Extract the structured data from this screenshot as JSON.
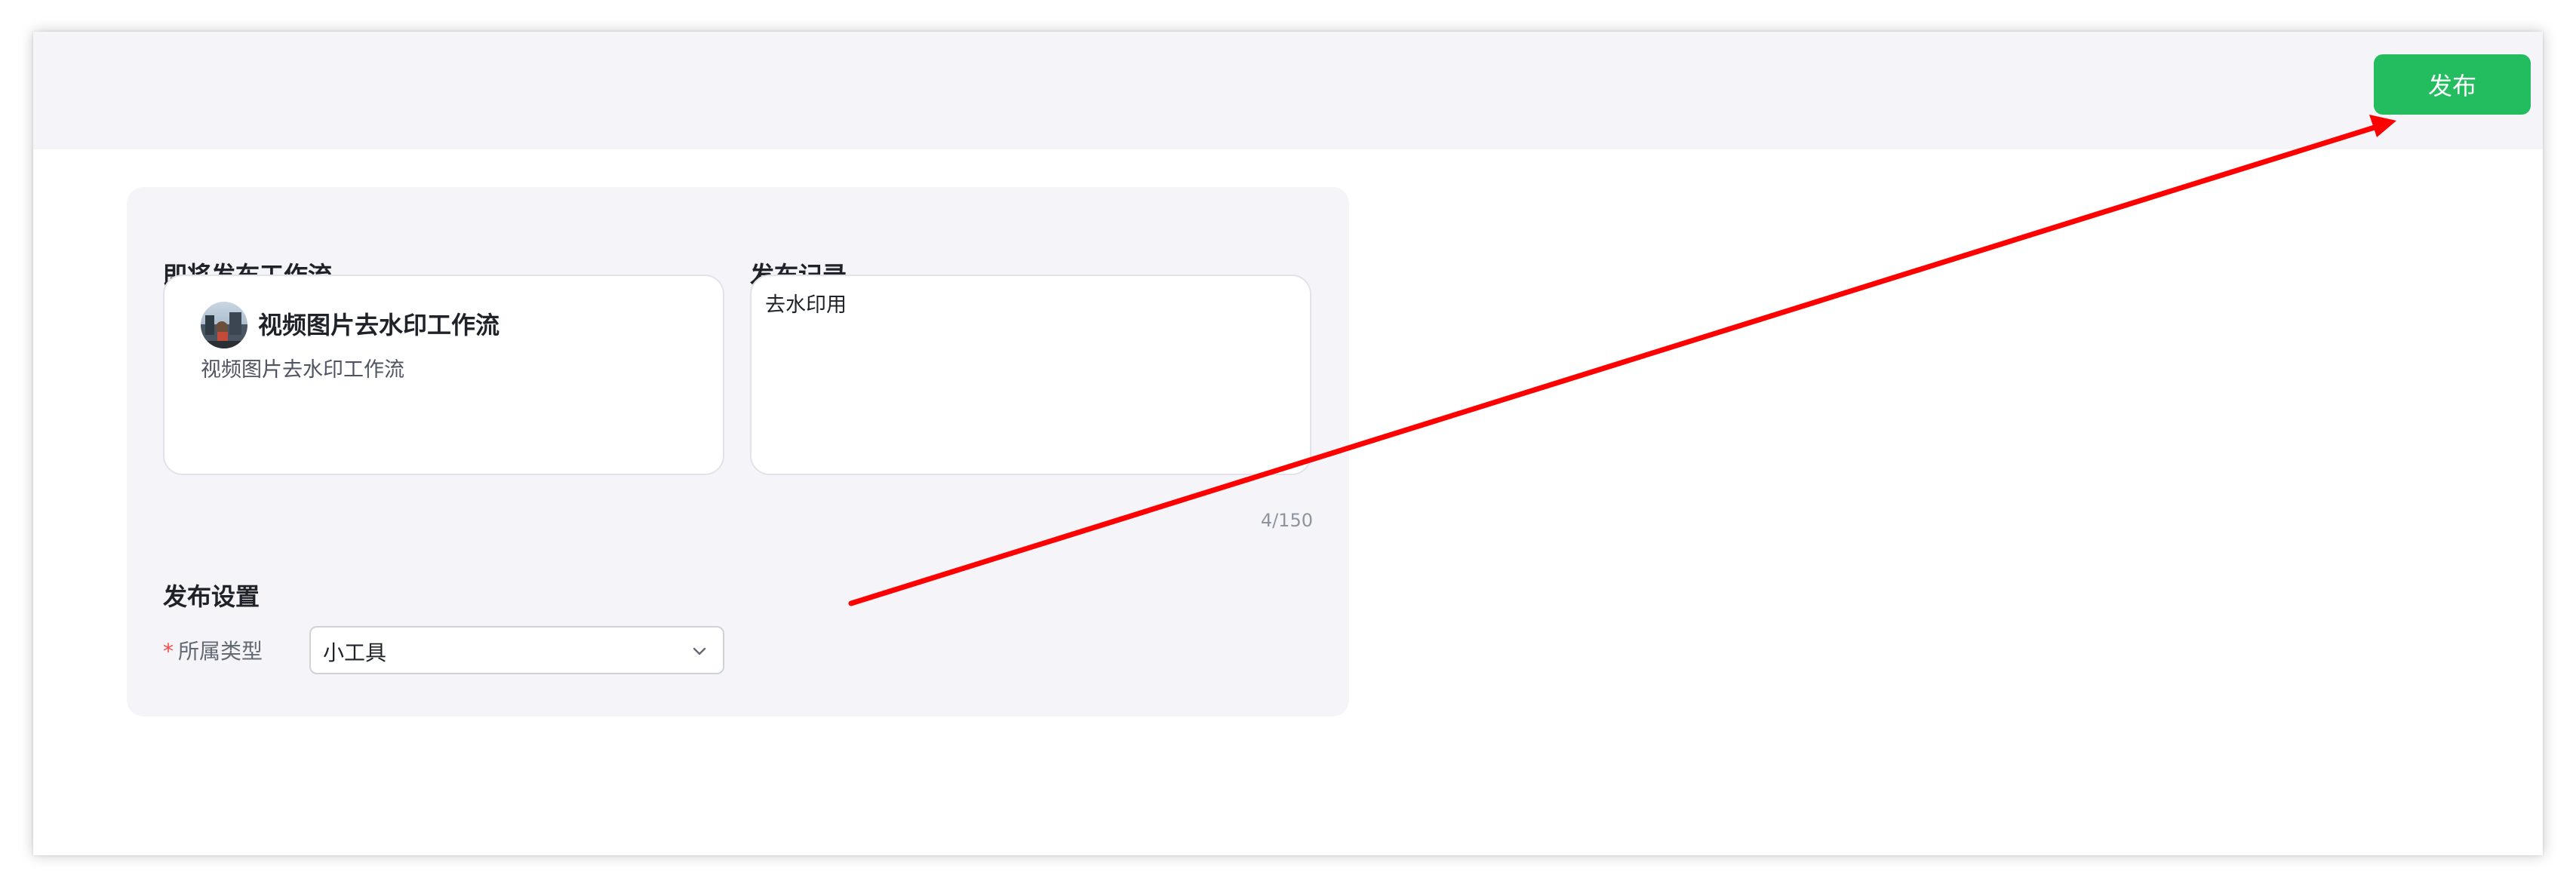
{
  "header": {
    "publish_button": "发布"
  },
  "workflow_section": {
    "title": "即将发布工作流",
    "card": {
      "name": "视频图片去水印工作流",
      "description": "视频图片去水印工作流"
    }
  },
  "record_section": {
    "title": "发布记录",
    "value": "去水印用",
    "counter": "4/150"
  },
  "settings_section": {
    "title": "发布设置",
    "required_mark": "*",
    "type_label": "所属类型",
    "type_value": "小工具"
  },
  "colors": {
    "primary_green": "#23bd60",
    "annotation_arrow": "#ff0000",
    "required_red": "#f54a45"
  },
  "icons": {
    "avatar": "workflow-avatar",
    "select_chevron": "chevron-down-icon"
  }
}
